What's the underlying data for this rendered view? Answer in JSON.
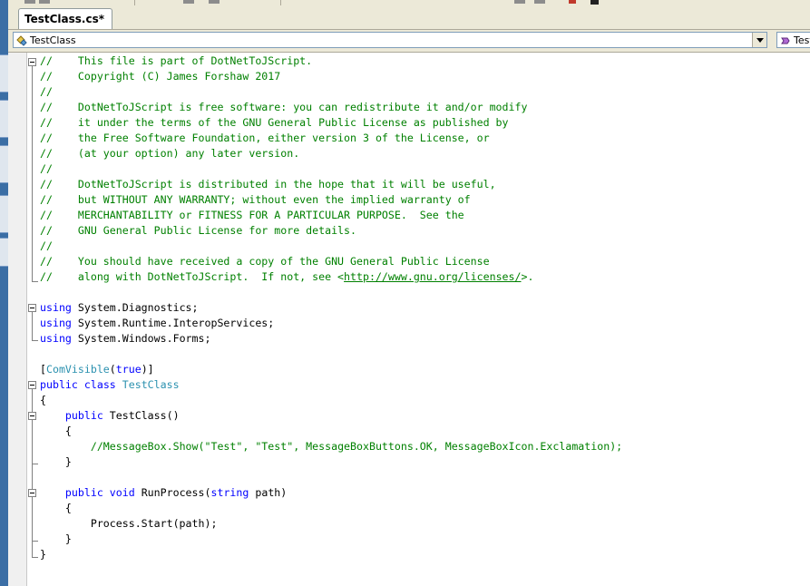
{
  "tab": {
    "title": "TestClass.cs*"
  },
  "navigation": {
    "type_dropdown_value": "TestClass",
    "member_dropdown_value": "TestClass"
  },
  "code_lines": [
    [
      [
        "cm",
        "//    This file is part of DotNetToJScript."
      ]
    ],
    [
      [
        "cm",
        "//    Copyright (C) James Forshaw 2017"
      ]
    ],
    [
      [
        "cm",
        "//"
      ]
    ],
    [
      [
        "cm",
        "//    DotNetToJScript is free software: you can redistribute it and/or modify"
      ]
    ],
    [
      [
        "cm",
        "//    it under the terms of the GNU General Public License as published by"
      ]
    ],
    [
      [
        "cm",
        "//    the Free Software Foundation, either version 3 of the License, or"
      ]
    ],
    [
      [
        "cm",
        "//    (at your option) any later version."
      ]
    ],
    [
      [
        "cm",
        "//"
      ]
    ],
    [
      [
        "cm",
        "//    DotNetToJScript is distributed in the hope that it will be useful,"
      ]
    ],
    [
      [
        "cm",
        "//    but WITHOUT ANY WARRANTY; without even the implied warranty of"
      ]
    ],
    [
      [
        "cm",
        "//    MERCHANTABILITY or FITNESS FOR A PARTICULAR PURPOSE.  See the"
      ]
    ],
    [
      [
        "cm",
        "//    GNU General Public License for more details."
      ]
    ],
    [
      [
        "cm",
        "//"
      ]
    ],
    [
      [
        "cm",
        "//    You should have received a copy of the GNU General Public License"
      ]
    ],
    [
      [
        "cm",
        "//    along with DotNetToJScript.  If not, see <"
      ],
      [
        "cm lnk",
        "http://www.gnu.org/licenses/"
      ],
      [
        "cm",
        ">."
      ]
    ],
    [],
    [
      [
        "kw",
        "using"
      ],
      [
        "pl",
        " System.Diagnostics;"
      ]
    ],
    [
      [
        "kw",
        "using"
      ],
      [
        "pl",
        " System.Runtime.InteropServices;"
      ]
    ],
    [
      [
        "kw",
        "using"
      ],
      [
        "pl",
        " System.Windows.Forms;"
      ]
    ],
    [],
    [
      [
        "pl",
        "["
      ],
      [
        "ty",
        "ComVisible"
      ],
      [
        "pl",
        "("
      ],
      [
        "kw",
        "true"
      ],
      [
        "pl",
        ")]"
      ]
    ],
    [
      [
        "kw",
        "public"
      ],
      [
        "pl",
        " "
      ],
      [
        "kw",
        "class"
      ],
      [
        "pl",
        " "
      ],
      [
        "ty",
        "TestClass"
      ]
    ],
    [
      [
        "pl",
        "{"
      ]
    ],
    [
      [
        "pl",
        "    "
      ],
      [
        "kw",
        "public"
      ],
      [
        "pl",
        " TestClass()"
      ]
    ],
    [
      [
        "pl",
        "    {"
      ]
    ],
    [
      [
        "pl",
        "        "
      ],
      [
        "cm",
        "//MessageBox.Show(\"Test\", \"Test\", MessageBoxButtons.OK, MessageBoxIcon.Exclamation);"
      ]
    ],
    [
      [
        "pl",
        "    }"
      ]
    ],
    [],
    [
      [
        "pl",
        "    "
      ],
      [
        "kw",
        "public"
      ],
      [
        "pl",
        " "
      ],
      [
        "kw",
        "void"
      ],
      [
        "pl",
        " RunProcess("
      ],
      [
        "kw",
        "string"
      ],
      [
        "pl",
        " path)"
      ]
    ],
    [
      [
        "pl",
        "    {"
      ]
    ],
    [
      [
        "pl",
        "        Process.Start(path);"
      ]
    ],
    [
      [
        "pl",
        "    }"
      ]
    ],
    [
      [
        "pl",
        "}"
      ]
    ]
  ],
  "colors": {
    "keyword": "#0000ff",
    "comment": "#008000",
    "type": "#2b91af",
    "chrome": "#ece9d8"
  }
}
